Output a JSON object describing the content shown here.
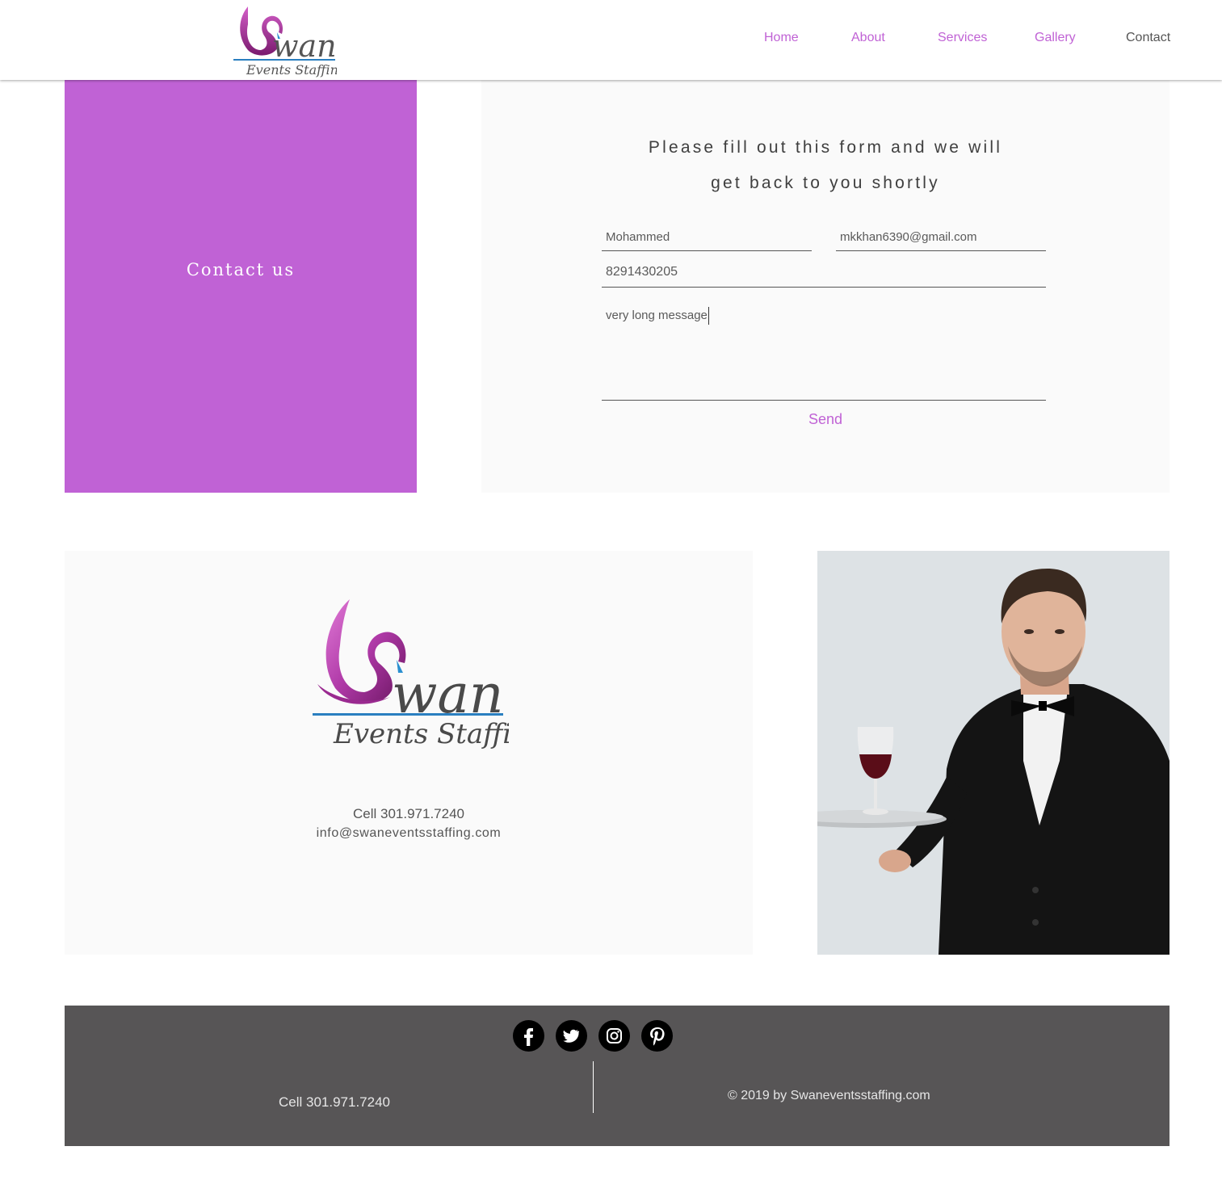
{
  "header": {
    "logo": {
      "main": "wan",
      "sub": "Events Staffing"
    },
    "nav": [
      "Home",
      "About",
      "Services",
      "Gallery",
      "Contact"
    ]
  },
  "contact_panel": {
    "title": "Contact us"
  },
  "form": {
    "heading_line1": "Please fill out this form and we will",
    "heading_line2": "get back to you shortly",
    "name_value": "Mohammed",
    "email_value": "mkkhan6390@gmail.com",
    "phone_value": "8291430205",
    "message_value": "very long message",
    "send_label": "Send"
  },
  "info": {
    "logo": {
      "main": "wan",
      "sub": "Events Staffing"
    },
    "cell": "Cell 301.971.7240",
    "email": "info@swaneventsstaffing.com"
  },
  "footer": {
    "social": [
      "facebook-icon",
      "twitter-icon",
      "instagram-icon",
      "pinterest-icon"
    ],
    "cell": "Cell 301.971.7240",
    "copyright": "© 2019 by Swaneventsstaffing.com"
  },
  "colors": {
    "accent": "#c062d5",
    "footer_bg": "#575556",
    "panel_bg": "#fafafa",
    "text": "#555555"
  }
}
